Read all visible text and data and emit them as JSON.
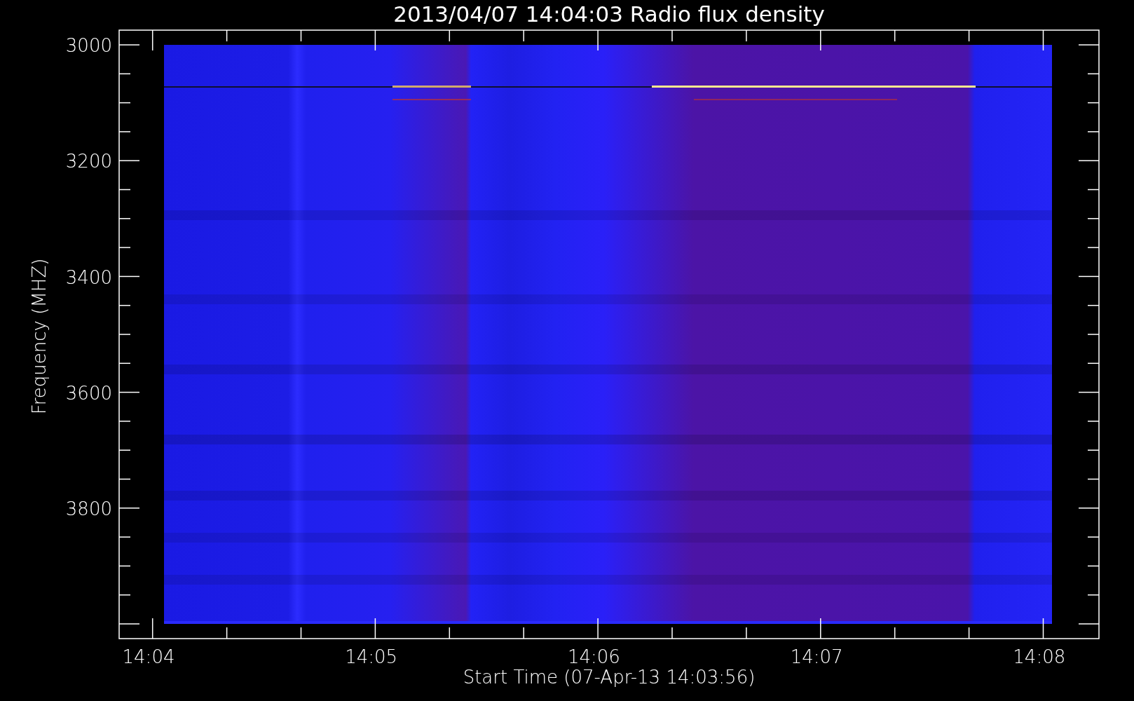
{
  "plot": {
    "title": "2013/04/07 14:04:03 Radio flux density",
    "xlabel": "Start Time (07-Apr-13 14:03:56)",
    "ylabel": "Frequency (MHZ)",
    "x_tick_labels": [
      "14:04",
      "14:05",
      "14:06",
      "14:07",
      "14:08"
    ],
    "y_tick_labels": [
      "3000",
      "3200",
      "3400",
      "3600",
      "3800"
    ]
  }
}
